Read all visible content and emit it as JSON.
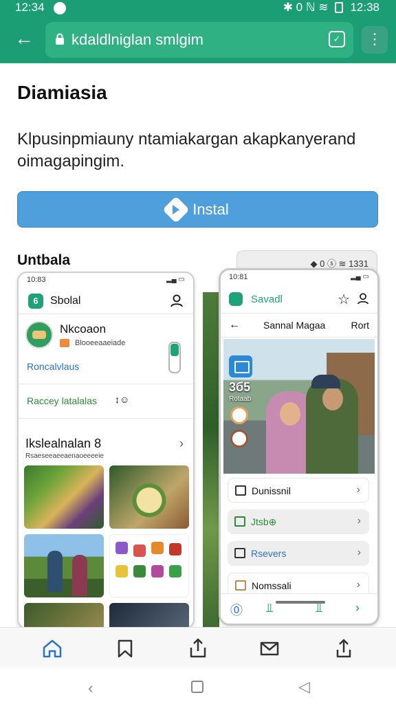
{
  "status_bar": {
    "time": "12:34",
    "right_time": "12:38",
    "indicators": "✱ 0 ℕ ≋"
  },
  "browser": {
    "url": "kdaldlniglan smlgim",
    "menu_icon": "vertical-dots-icon"
  },
  "page": {
    "title": "Diamiasia",
    "description": "Klpusinpmiauny ntamiakargan akapkanyerand oimagapingim.",
    "install_label": "Instal",
    "section_label": "Untbala"
  },
  "phone1": {
    "time": "10:83",
    "app_name": "Sbolal",
    "app_logo": "6",
    "profile_name": "Nkcoaon",
    "profile_sub": "Blooeeaaeiade",
    "profile_link": "Roncalvlaus",
    "row_label": "Raccey latalalas",
    "row_mark": "↕☺",
    "section_title": "Ikslealnalan 8",
    "section_sub": "Rsaeseeaeeaenaoeeeeie"
  },
  "phone_back": {
    "indicators": "◆ 0 ⓢ ≋ 1331"
  },
  "phone2": {
    "time": "10:81",
    "app_name": "Savadl",
    "nav_title": "Sannal Magaa",
    "nav_right": "Rort",
    "photo_number": "3б5",
    "photo_caption": "Rotaab",
    "items": [
      {
        "label": "Dunissnil"
      },
      {
        "label": "Jtsb⊕"
      },
      {
        "label": "Rsevers"
      },
      {
        "label": "Nomssali"
      }
    ]
  },
  "bottom_nav": {
    "icons": [
      "home-icon",
      "bookmark-icon",
      "share-icon",
      "mail-icon",
      "upload-icon"
    ]
  },
  "colors": {
    "brand_green": "#1c9e74",
    "install_blue": "#4f9fdc",
    "link_blue": "#2a73c9"
  }
}
